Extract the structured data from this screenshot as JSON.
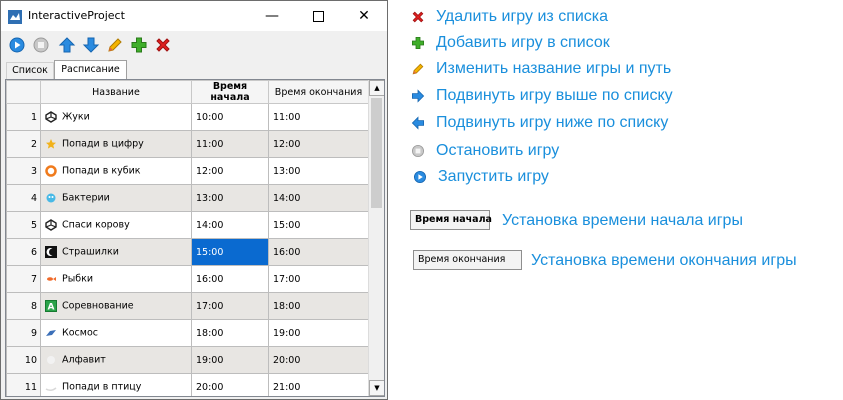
{
  "window": {
    "title": "InteractiveProject",
    "min_glyph": "—",
    "close_glyph": "✕"
  },
  "tabs": [
    {
      "label": "Список"
    },
    {
      "label": "Расписание"
    }
  ],
  "grid": {
    "headers": [
      "Название",
      "Время начала",
      "Время окончания"
    ],
    "rows": [
      {
        "n": "1",
        "name": "Жуки",
        "start": "10:00",
        "end": "11:00",
        "icon": "unity-icon"
      },
      {
        "n": "2",
        "name": "Попади в цифру",
        "start": "11:00",
        "end": "12:00",
        "icon": "star-icon"
      },
      {
        "n": "3",
        "name": "Попади в кубик",
        "start": "12:00",
        "end": "13:00",
        "icon": "ring-icon"
      },
      {
        "n": "4",
        "name": "Бактерии",
        "start": "13:00",
        "end": "14:00",
        "icon": "bacteria-icon"
      },
      {
        "n": "5",
        "name": "Спаси корову",
        "start": "14:00",
        "end": "15:00",
        "icon": "unity-icon"
      },
      {
        "n": "6",
        "name": "Страшилки",
        "start": "15:00",
        "end": "16:00",
        "icon": "moon-icon"
      },
      {
        "n": "7",
        "name": "Рыбки",
        "start": "16:00",
        "end": "17:00",
        "icon": "fish-icon"
      },
      {
        "n": "8",
        "name": "Соревнование",
        "start": "17:00",
        "end": "18:00",
        "icon": "letter-a-icon"
      },
      {
        "n": "9",
        "name": "Космос",
        "start": "18:00",
        "end": "19:00",
        "icon": "space-icon"
      },
      {
        "n": "10",
        "name": "Алфавит",
        "start": "19:00",
        "end": "20:00",
        "icon": "blank-icon"
      },
      {
        "n": "11",
        "name": "Попади в птицу",
        "start": "20:00",
        "end": "21:00",
        "icon": "bird-icon"
      }
    ]
  },
  "legend": {
    "delete": "Удалить игру из списка",
    "add": "Добавить игру в список",
    "edit": "Изменить название игры и путь",
    "move_up": "Подвинуть игру выше по списку",
    "move_down": "Подвинуть игру ниже по списку",
    "stop": "Остановить игру",
    "start": "Запустить игру",
    "start_time": "Установка  времени начала игры",
    "end_time": "Установка времени окончания игры"
  },
  "legend_buttons": {
    "start_time_label": "Время начала",
    "end_time_label": "Время окончания"
  },
  "colors": {
    "legend_text": "#1a8fdc",
    "selection": "#0a6ad0",
    "alt_row": "#e8e6e3"
  }
}
